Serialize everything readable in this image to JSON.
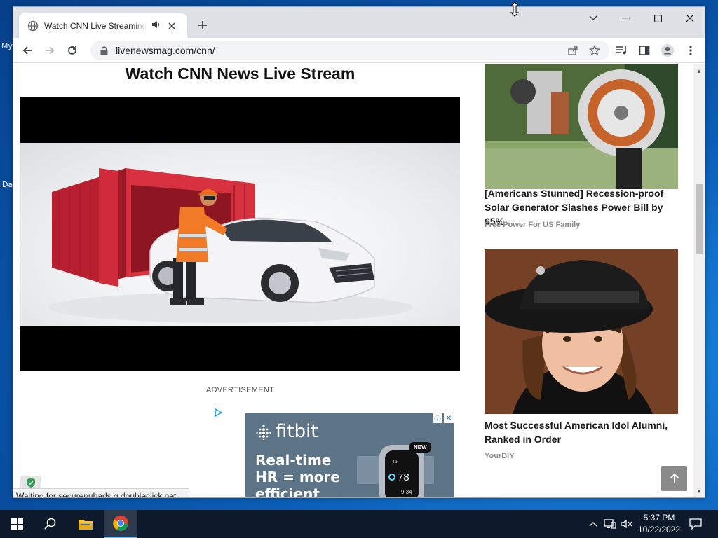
{
  "desktop": {
    "icon_labels": [
      "My",
      "Da"
    ]
  },
  "browser": {
    "tab": {
      "title": "Watch CNN Live Streaming - ",
      "audio_icon": "speaker-icon",
      "favicon": "globe-icon"
    },
    "address": {
      "url": "livenewsmag.com/cnn/"
    },
    "status_text": "Waiting for securepubads.g.doubleclick.net..."
  },
  "page": {
    "title": "Watch CNN News Live Stream",
    "advertisement_label": "ADVERTISEMENT",
    "fitbit_ad": {
      "brand": "fitbit",
      "headline_lines": [
        "Real-time",
        "HR = more",
        "efficient"
      ],
      "badge": "NEW",
      "watch_number": "78",
      "watch_time": "9:34",
      "watch_top": "45"
    },
    "sidebar": [
      {
        "headline": "[Americans Stunned] Recession-proof Solar Generator Slashes Power Bill by 65%",
        "source": "Free Power For US Family"
      },
      {
        "headline": "Most Successful American Idol Alumni, Ranked in Order",
        "source": "YourDIY"
      }
    ]
  },
  "taskbar": {
    "time": "5:37 PM",
    "date": "10/22/2022"
  },
  "colors": {
    "tabstrip": "#dee1e6",
    "taskbar": "#0d1a2b",
    "fitbit_bg": "#5d7487",
    "container_red": "#c8283a"
  }
}
